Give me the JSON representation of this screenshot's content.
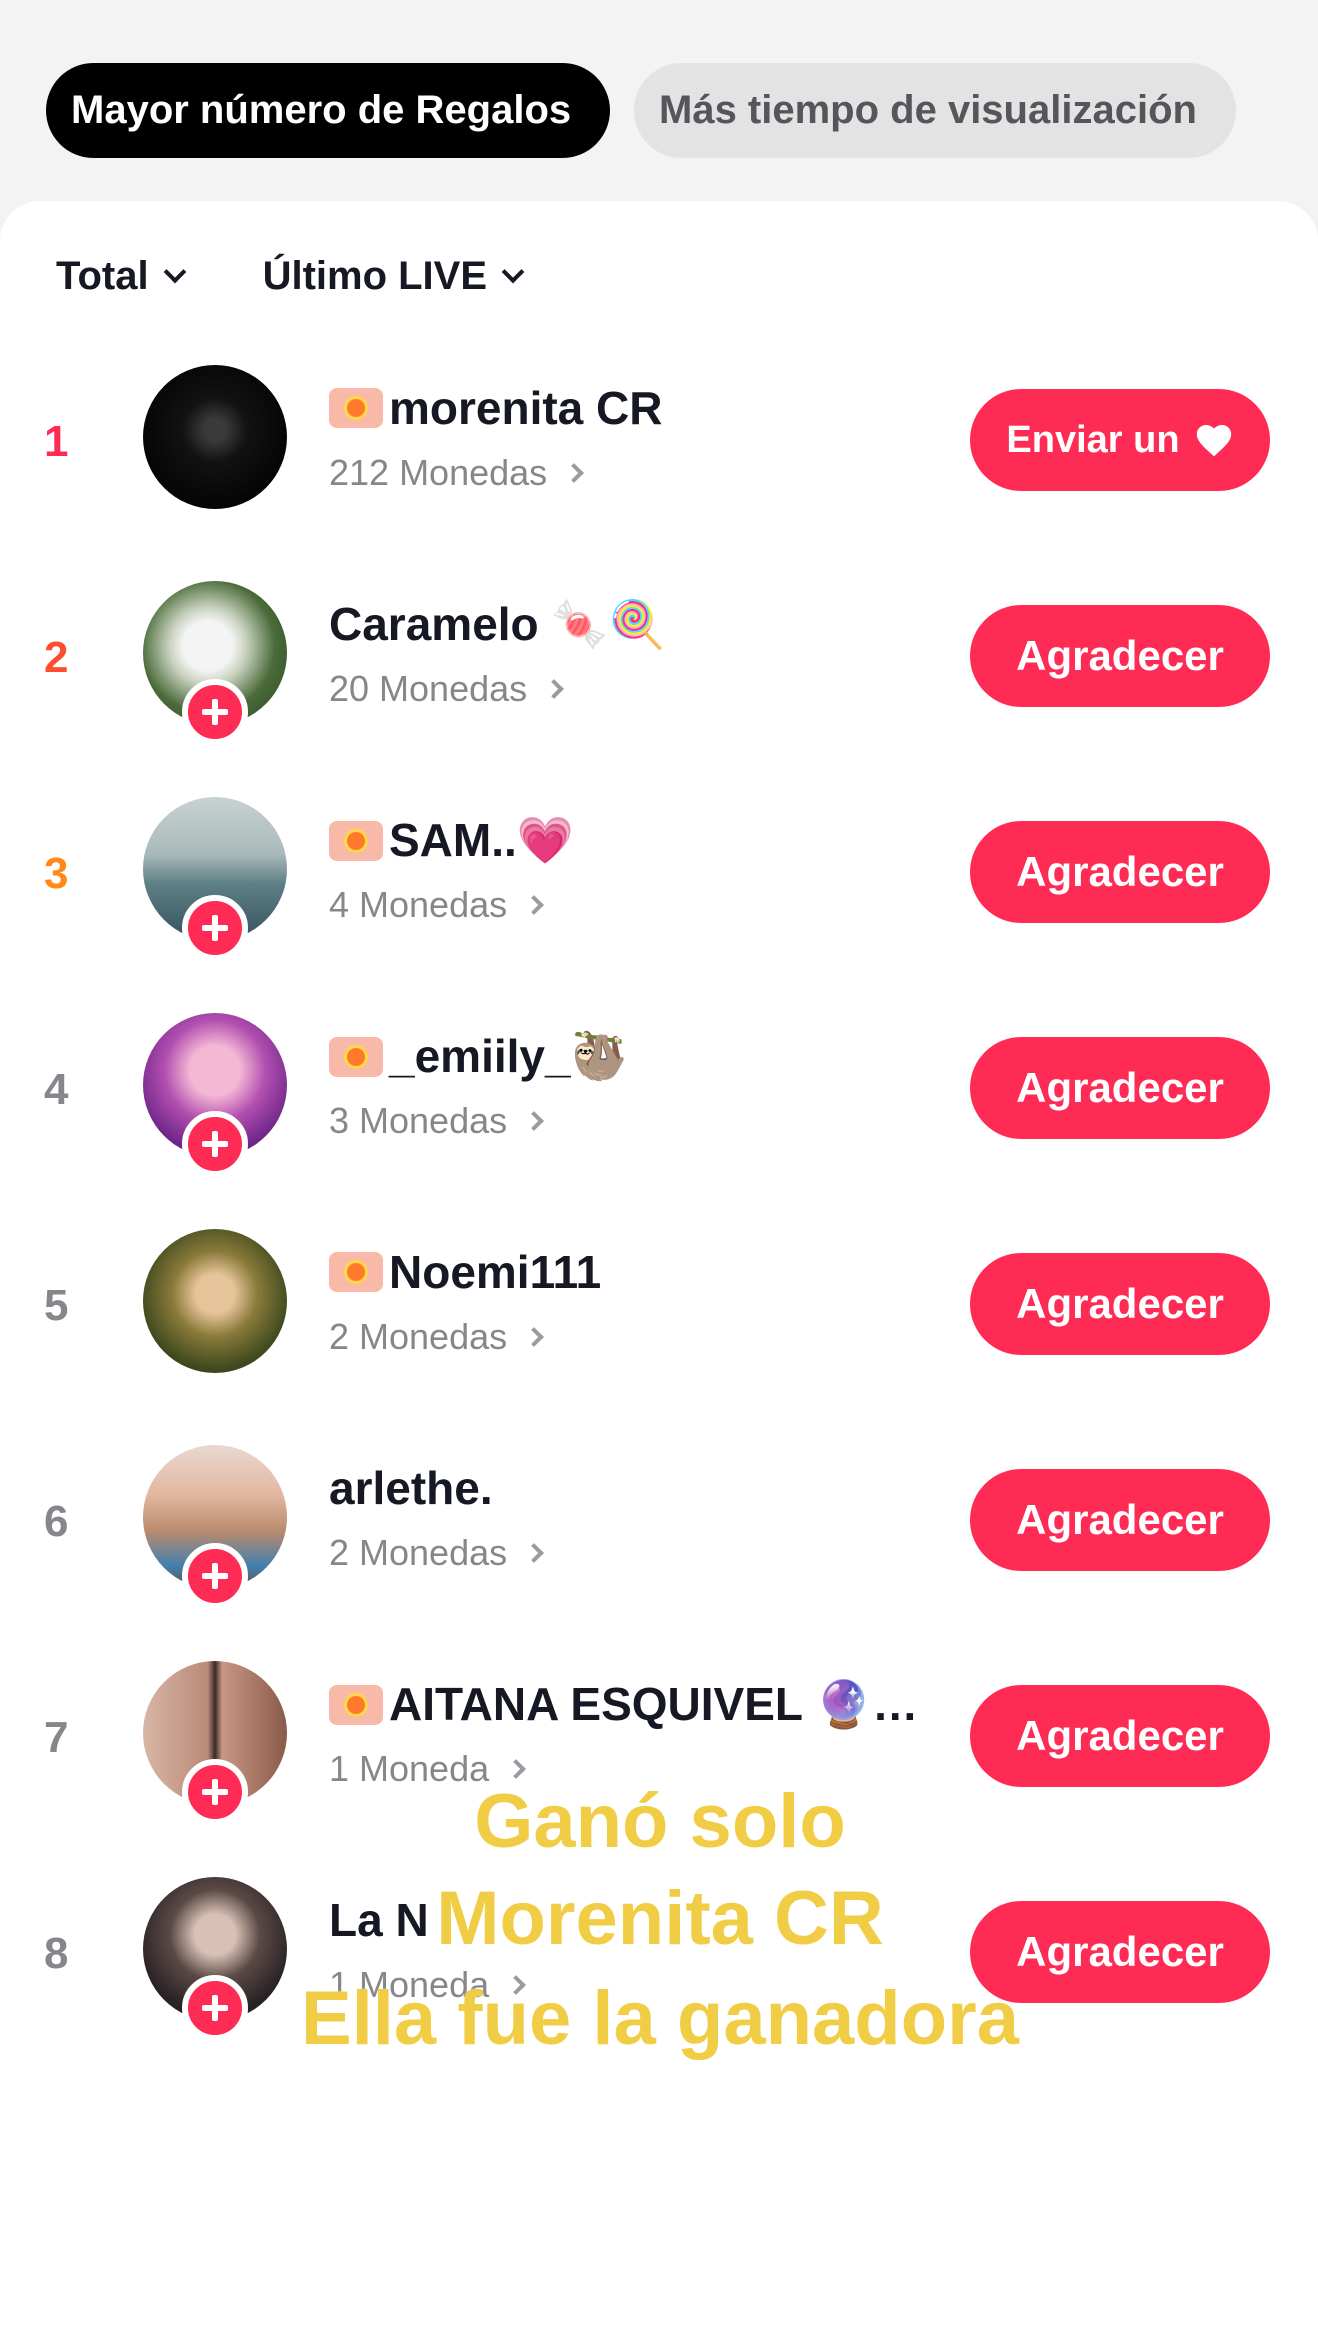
{
  "tabs": [
    {
      "label": "Mayor número de Regalos",
      "active": true
    },
    {
      "label": "Más tiempo de visualización",
      "active": false
    }
  ],
  "filters": {
    "scope": "Total",
    "period": "Último LIVE"
  },
  "ranking": [
    {
      "rank": "1",
      "name": "morenita CR",
      "coins": "212 Monedas",
      "button": "Enviar un",
      "badge": true,
      "follow": false
    },
    {
      "rank": "2",
      "name": "Caramelo 🍬🍭",
      "coins": "20 Monedas",
      "button": "Agradecer",
      "badge": false,
      "follow": true
    },
    {
      "rank": "3",
      "name": "SAM..💗",
      "coins": "4 Monedas",
      "button": "Agradecer",
      "badge": true,
      "follow": true
    },
    {
      "rank": "4",
      "name": "_emiily_🦥",
      "coins": "3 Monedas",
      "button": "Agradecer",
      "badge": true,
      "follow": true
    },
    {
      "rank": "5",
      "name": "Noemi111",
      "coins": "2 Monedas",
      "button": "Agradecer",
      "badge": true,
      "follow": false
    },
    {
      "rank": "6",
      "name": "arlethe.",
      "coins": "2 Monedas",
      "button": "Agradecer",
      "badge": false,
      "follow": true
    },
    {
      "rank": "7",
      "name": "AITANA ESQUIVEL 🔮…",
      "coins": "1 Moneda",
      "button": "Agradecer",
      "badge": true,
      "follow": true
    },
    {
      "rank": "8",
      "name": "La N",
      "coins": "1 Moneda",
      "button": "Agradecer",
      "badge": false,
      "follow": true
    }
  ],
  "overlay_caption": [
    "Ganó solo",
    "Morenita CR",
    "Ella fue la ganadora"
  ],
  "colors": {
    "accent": "#fe2c55",
    "caption": "#f1cc45"
  },
  "icons": {
    "heart": "heart-icon",
    "follow": "plus-icon",
    "chevron": "chevron-right-icon"
  }
}
